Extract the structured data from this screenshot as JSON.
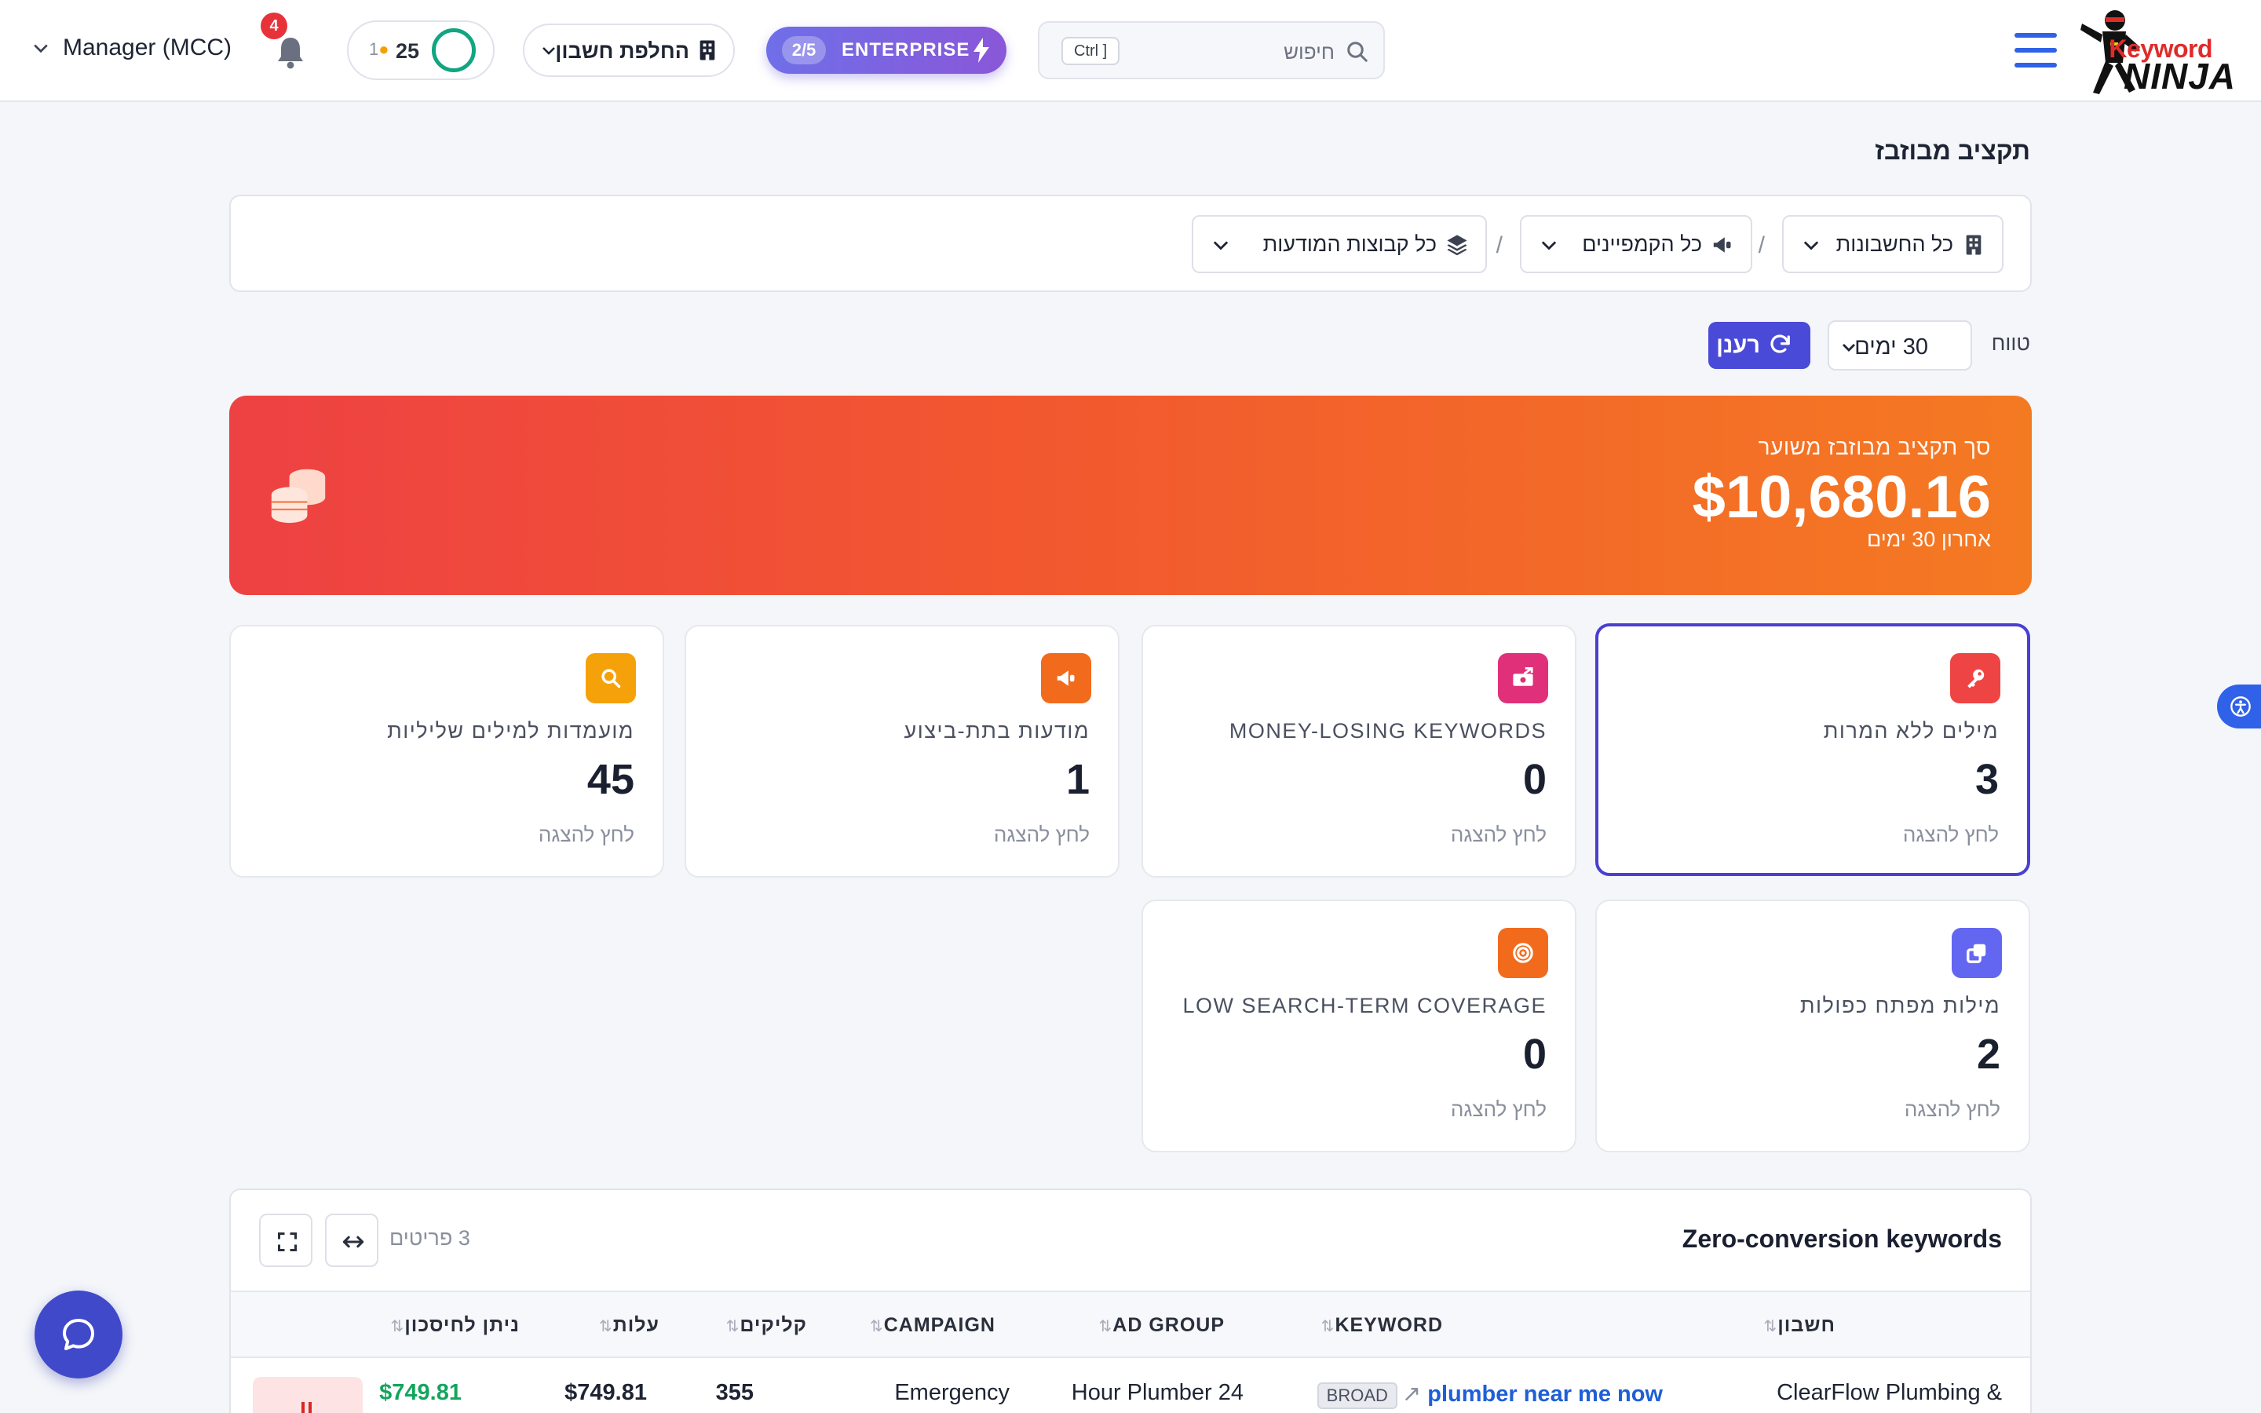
{
  "header": {
    "logo": {
      "line1": "Keyword",
      "line2": "NINJA"
    },
    "search": {
      "placeholder": "חיפוש",
      "shortcut": "Ctrl ]"
    },
    "plan": {
      "usage": "2/5",
      "label": "ENTERPRISE"
    },
    "switch_account": "החלפת חשבון",
    "points": {
      "score": "25",
      "streak": "1"
    },
    "notifications_count": "4",
    "account": "Manager (MCC)"
  },
  "page": {
    "title": "תקציב מבוזבז",
    "filters": {
      "accounts": "כל החשבונות",
      "campaigns": "כל הקמפיינים",
      "ad_groups": "כל קבוצות המודעות",
      "separator": "/"
    },
    "range_label": "טווח",
    "range_value": "30 ימים",
    "refresh_label": "רענן"
  },
  "hero": {
    "caption": "סך תקציב מבוזבז משוער",
    "amount": "$10,680.16",
    "period": "אחרון 30 ימים"
  },
  "cards": [
    {
      "title": "מילים ללא המרות",
      "value": "3",
      "hint": "לחץ להצגה",
      "color": "#ef4444",
      "icon": "key-icon"
    },
    {
      "title": "MONEY-LOSING KEYWORDS",
      "value": "0",
      "hint": "לחץ להצגה",
      "color": "#e0307a",
      "icon": "money-icon"
    },
    {
      "title": "מודעות בתת-ביצוע",
      "value": "1",
      "hint": "לחץ להצגה",
      "color": "#f26b1d",
      "icon": "megaphone-icon"
    },
    {
      "title": "מועמדות למילים שליליות",
      "value": "45",
      "hint": "לחץ להצגה",
      "color": "#f5a10a",
      "icon": "search-icon"
    },
    {
      "title": "מילות מפתח כפולות",
      "value": "2",
      "hint": "לחץ להצגה",
      "color": "#6366f1",
      "icon": "copy-icon"
    },
    {
      "title": "LOW SEARCH-TERM COVERAGE",
      "value": "0",
      "hint": "לחץ להצגה",
      "color": "#f26b1d",
      "icon": "target-icon"
    }
  ],
  "table": {
    "title": "Zero-conversion keywords",
    "count": "3 פריטים",
    "columns": {
      "account": "חשבון",
      "keyword": "KEYWORD",
      "ad_group": "AD GROUP",
      "campaign": "CAMPAIGN",
      "clicks": "קליקים",
      "cost": "עלות",
      "savings": "ניתן לחיסכון"
    },
    "rows": [
      {
        "account": "ClearFlow Plumbing &",
        "keyword": "plumber near me now",
        "match": "BROAD",
        "ad_group": "24 Hour Plumber",
        "campaign": "Emergency",
        "clicks": "355",
        "cost": "$749.81",
        "savings": "$749.81"
      }
    ]
  }
}
